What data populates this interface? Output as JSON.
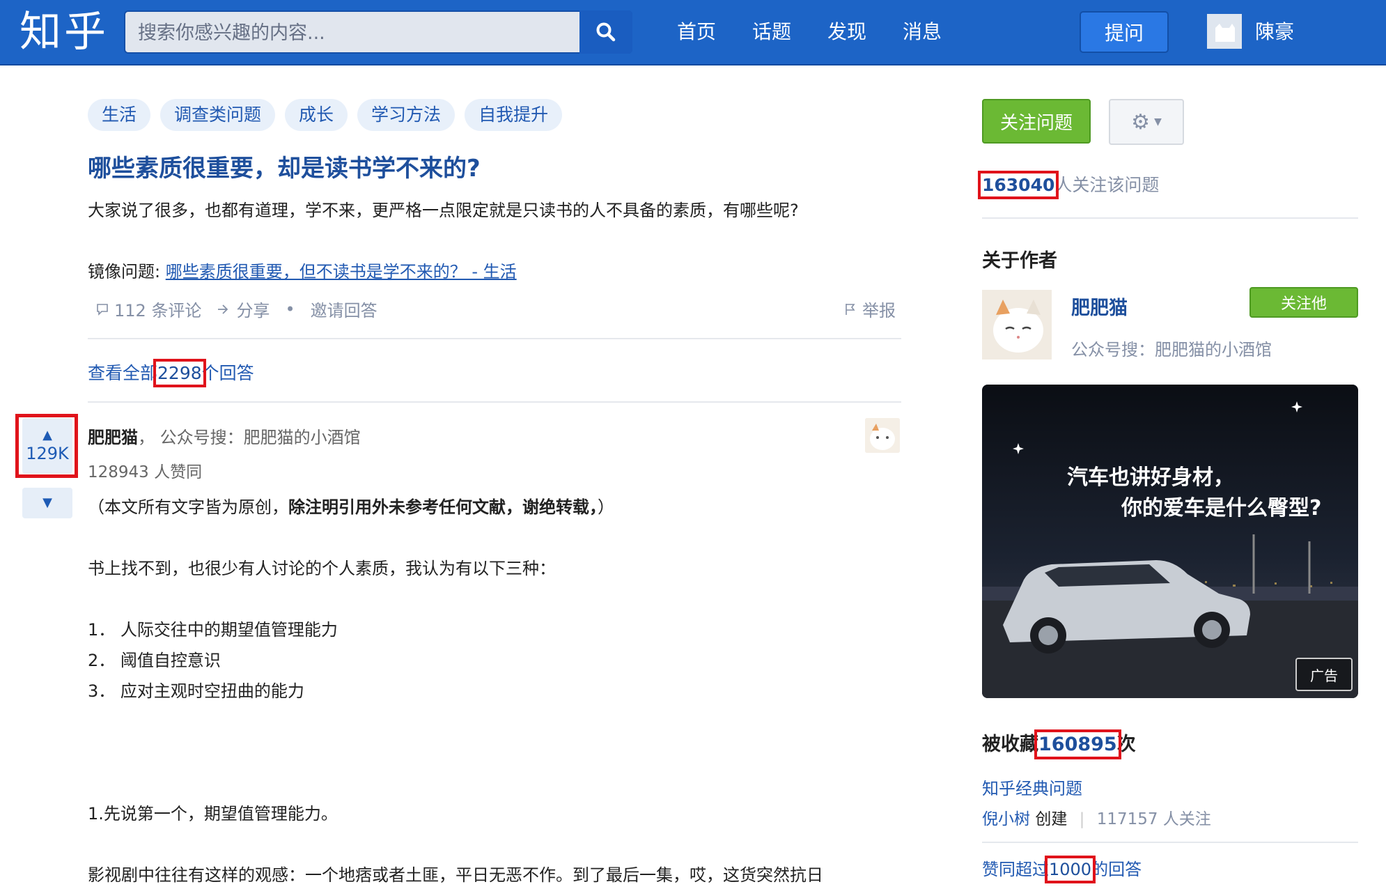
{
  "header": {
    "logo": "知乎",
    "search_placeholder": "搜索你感兴趣的内容...",
    "nav": [
      "首页",
      "话题",
      "发现",
      "消息"
    ],
    "ask_label": "提问",
    "username": "陳豪"
  },
  "question": {
    "tags": [
      "生活",
      "调查类问题",
      "成长",
      "学习方法",
      "自我提升"
    ],
    "title": "哪些素质很重要，却是读书学不来的?",
    "description": "大家说了很多，也都有道理，学不来，更严格一点限定就是只读书的人不具备的素质，有哪些呢?",
    "mirror_label": "镜像问题:",
    "mirror_link": "哪些素质很重要，但不读书是学不来的？ - 生活",
    "comments": "112 条评论",
    "share": "分享",
    "dot": "•",
    "invite": "邀请回答",
    "report": "举报",
    "view_all_prefix": "查看全部",
    "answer_count": "2298",
    "view_all_suffix": "个回答"
  },
  "answer": {
    "upvotes_short": "129K",
    "author": "肥肥猫",
    "author_bio": "公众号搜：肥肥猫的小酒馆",
    "likes": "128943 人赞同",
    "p1_pre": "（本文所有文字皆为原创，",
    "p1_bold": "除注明引用外未参考任何文献，谢绝转载，",
    "p1_post": "）",
    "p2": "书上找不到，也很少有人讨论的个人素质，我认为有以下三种：",
    "list": [
      "1． 人际交往中的期望值管理能力",
      "2． 阈值自控意识",
      "3． 应对主观时空扭曲的能力"
    ],
    "p3": "1.先说第一个，期望值管理能力。",
    "p4": "影视剧中往往有这样的观感：一个地痞或者土匪，平日无恶不作。到了最后一集，哎，这货突然抗日"
  },
  "sidebar": {
    "follow_question": "关注问题",
    "follower_count": "163040",
    "follower_suffix": "人关注该问题",
    "about_author": "关于作者",
    "author_name": "肥肥猫",
    "author_bio": "公众号搜：肥肥猫的小酒馆",
    "follow_him": "关注他",
    "ad_line1": "汽车也讲好身材，",
    "ad_line2": "你的爱车是什么臀型?",
    "ad_badge": "广告",
    "collected_prefix": "被收藏",
    "collected_count": "160895",
    "collected_suffix": "次",
    "collection_name": "知乎经典问题",
    "collection_creator": "倪小树",
    "collection_created": "创建",
    "collection_followers": "117157 人关注",
    "collection2_prefix": "赞同超过",
    "collection2_num": "1000",
    "collection2_suffix": "的回答"
  },
  "colors": {
    "brand_blue": "#1d64c6",
    "link_blue": "#225ab2",
    "follow_green": "#6bb934",
    "highlight_red": "#e0131b"
  }
}
